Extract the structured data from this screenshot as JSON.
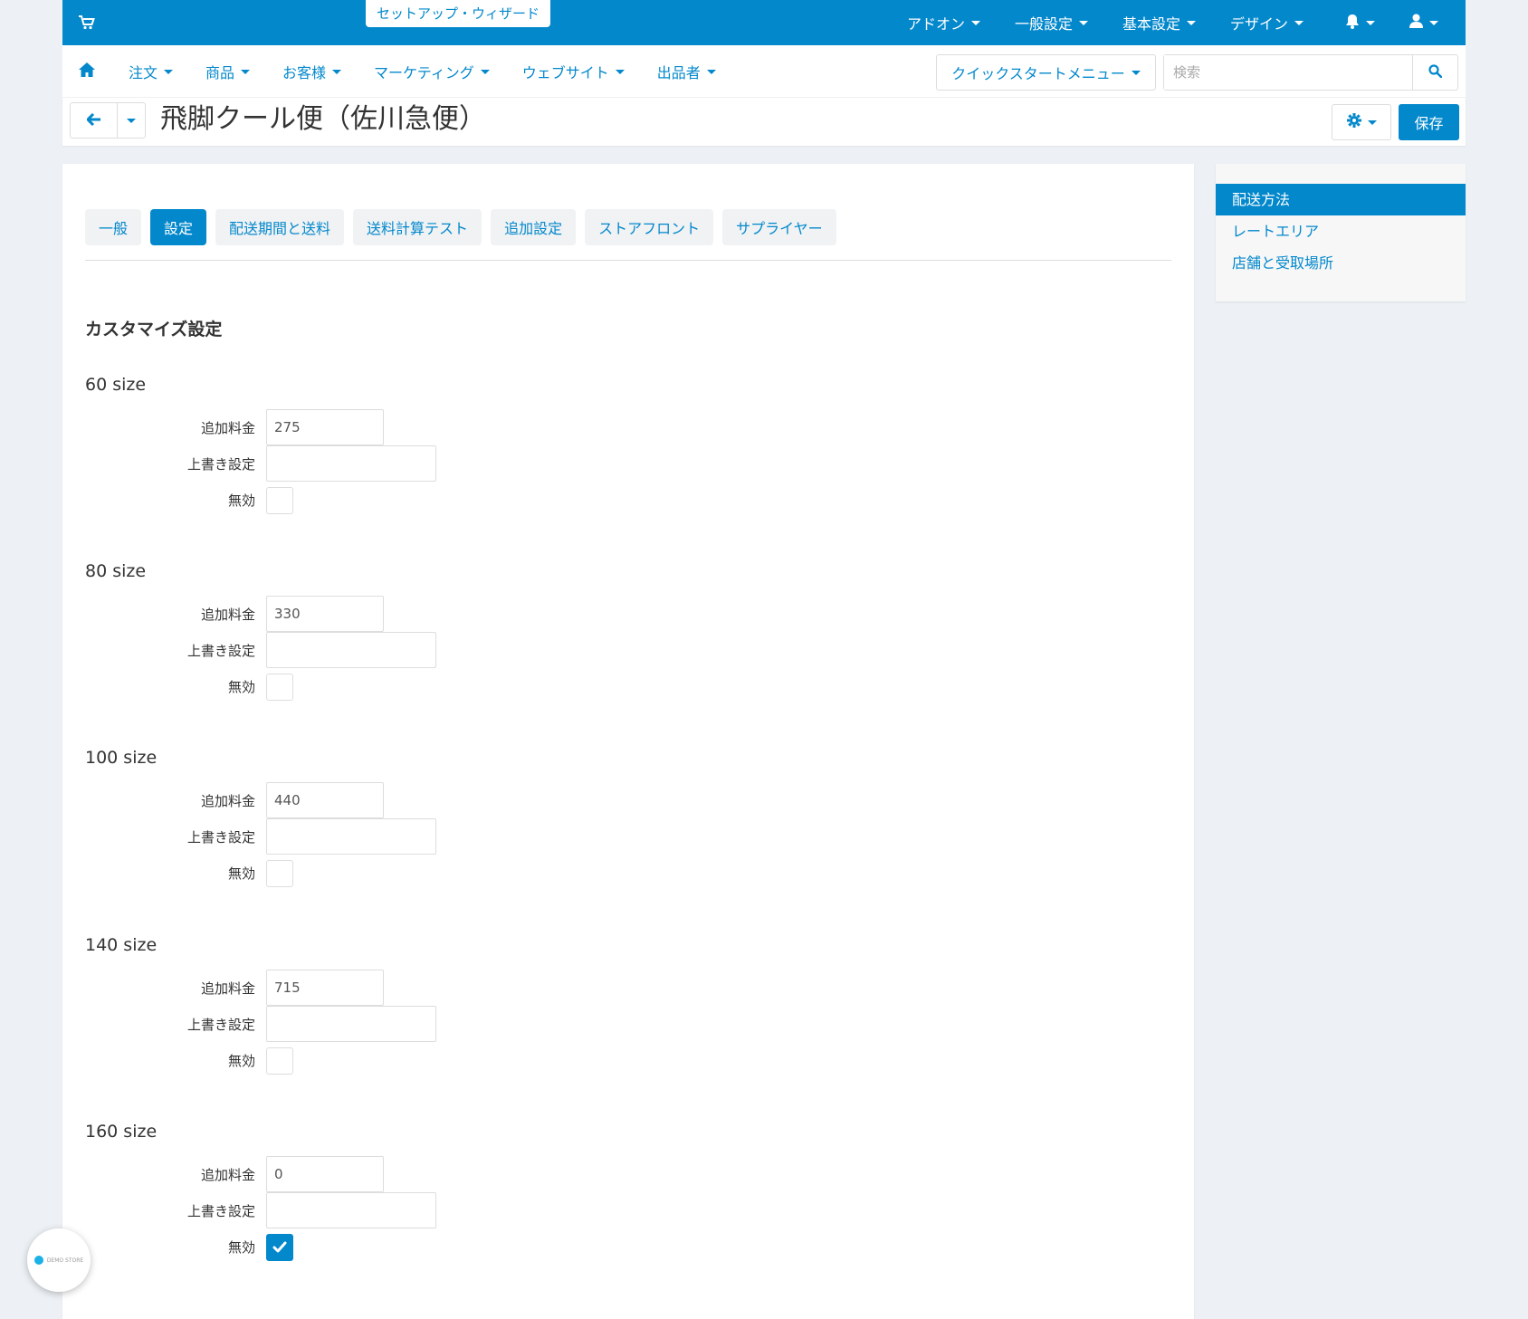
{
  "topbar": {
    "wizard": "セットアップ・ウィザード",
    "menu": [
      {
        "label": "アドオン"
      },
      {
        "label": "一般設定"
      },
      {
        "label": "基本設定"
      },
      {
        "label": "デザイン"
      }
    ],
    "icons": [
      "cart-icon",
      "bell-icon",
      "user-icon"
    ]
  },
  "navbar": {
    "items": [
      {
        "label": "注文"
      },
      {
        "label": "商品"
      },
      {
        "label": "お客様"
      },
      {
        "label": "マーケティング"
      },
      {
        "label": "ウェブサイト"
      },
      {
        "label": "出品者"
      }
    ],
    "quickstart": "クイックスタートメニュー",
    "search_placeholder": "検索"
  },
  "titlebar": {
    "title": "飛脚クール便（佐川急便）",
    "save": "保存"
  },
  "tabs": [
    {
      "label": "一般",
      "active": false
    },
    {
      "label": "設定",
      "active": true
    },
    {
      "label": "配送期間と送料",
      "active": false
    },
    {
      "label": "送料計算テスト",
      "active": false
    },
    {
      "label": "追加設定",
      "active": false
    },
    {
      "label": "ストアフロント",
      "active": false
    },
    {
      "label": "サプライヤー",
      "active": false
    }
  ],
  "section_title": "カスタマイズ設定",
  "field_labels": {
    "surcharge": "追加料金",
    "override": "上書き設定",
    "disabled": "無効"
  },
  "groups": [
    {
      "title": "60 size",
      "surcharge": "275",
      "override": "",
      "disabled": false
    },
    {
      "title": "80 size",
      "surcharge": "330",
      "override": "",
      "disabled": false
    },
    {
      "title": "100 size",
      "surcharge": "440",
      "override": "",
      "disabled": false
    },
    {
      "title": "140 size",
      "surcharge": "715",
      "override": "",
      "disabled": false
    },
    {
      "title": "160 size",
      "surcharge": "0",
      "override": "",
      "disabled": true
    }
  ],
  "side": {
    "items": [
      {
        "label": "配送方法",
        "active": true
      },
      {
        "label": "レートエリア",
        "active": false
      },
      {
        "label": "店舗と受取場所",
        "active": false
      }
    ]
  },
  "demo_badge": "DEMO STORE",
  "colors": {
    "accent": "#0388cc",
    "background": "#edf1f5"
  }
}
